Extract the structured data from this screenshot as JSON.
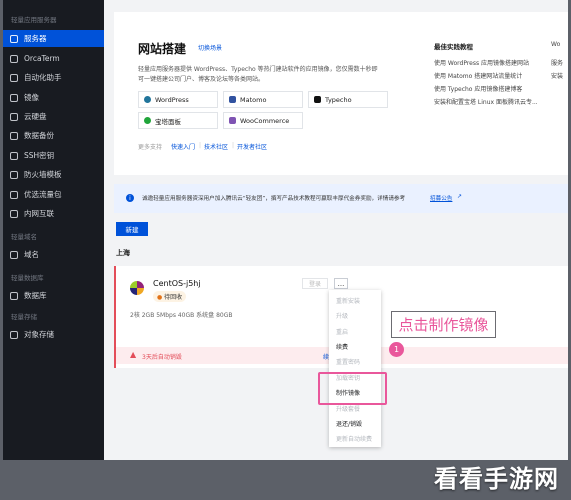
{
  "sidebar": {
    "top_group": "轻量应用服务器",
    "items": [
      {
        "label": "服务器",
        "icon": "server-icon"
      },
      {
        "label": "OrcaTerm",
        "icon": "terminal-icon"
      },
      {
        "label": "自动化助手",
        "icon": "automation-icon"
      },
      {
        "label": "镜像",
        "icon": "image-icon"
      },
      {
        "label": "云硬盘",
        "icon": "disk-icon"
      },
      {
        "label": "数据备份",
        "icon": "backup-icon"
      },
      {
        "label": "SSH密钥",
        "icon": "key-icon"
      },
      {
        "label": "防火墙模板",
        "icon": "firewall-icon"
      },
      {
        "label": "优选流量包",
        "icon": "traffic-icon"
      },
      {
        "label": "内网互联",
        "icon": "network-icon"
      }
    ],
    "group_domain": "轻量域名",
    "domain_item": "域名",
    "group_db": "轻量数据库",
    "db_item": "数据库",
    "group_storage": "轻量存储",
    "storage_item": "对象存储"
  },
  "site": {
    "title": "网站搭建",
    "switch_link": "切换场景",
    "desc_line1": "轻量应用服务器提供 WordPress、Typecho 等热门建站软件的应用镜像，您仅需数十秒即",
    "desc_line2": "可一键搭建公司门户、博客及论坛等各类网站。",
    "apps": [
      "WordPress",
      "Matomo",
      "Typecho",
      "宝塔面板",
      "WooCommerce"
    ],
    "support_label": "更多支持",
    "links": [
      "快速入门",
      "技术社区",
      "开发者社区"
    ]
  },
  "best_practices": {
    "title": "最佳实践教程",
    "items": [
      "使用 WordPress 应用镜像搭建网站",
      "使用 Matomo 搭建网站流量统计",
      "使用 Typecho 应用镜像搭建博客",
      "安装和配置宝塔 Linux 面板腾讯云专..."
    ],
    "more": [
      "Wo",
      "服务",
      "安装"
    ]
  },
  "notice": {
    "text": "诚邀轻量应用服务器资深用户加入腾讯云“轻友团”，撰写产品技术教程可赢取丰厚代金券奖励，详情请参考",
    "link": "招募公告"
  },
  "new_button": "新建",
  "region": "上海",
  "instance": {
    "name": "CentOS-j5hj",
    "status": "待回收",
    "specs": "2核 2GB  5Mbps  40GB  系统盘 80GB",
    "login": "登录",
    "more": "...",
    "warning": "3天后自动销毁",
    "renew": "续"
  },
  "menu": [
    {
      "label": "重新安装",
      "enabled": false
    },
    {
      "label": "升级",
      "enabled": false
    },
    {
      "label": "重启",
      "enabled": false
    },
    {
      "label": "续费",
      "enabled": true
    },
    {
      "label": "重置密码",
      "enabled": false
    },
    {
      "label": "加载密钥",
      "enabled": false
    },
    {
      "label": "制作镜像",
      "enabled": true
    },
    {
      "label": "升级套餐",
      "enabled": false
    },
    {
      "label": "退还/销毁",
      "enabled": true
    },
    {
      "label": "更新自动续费",
      "enabled": false
    }
  ],
  "callout": {
    "text": "点击制作镜像",
    "step": "1"
  },
  "watermark": "看看手游网",
  "colors": {
    "primary": "#0052d9",
    "highlight": "#e9579b",
    "danger": "#e34d59"
  }
}
